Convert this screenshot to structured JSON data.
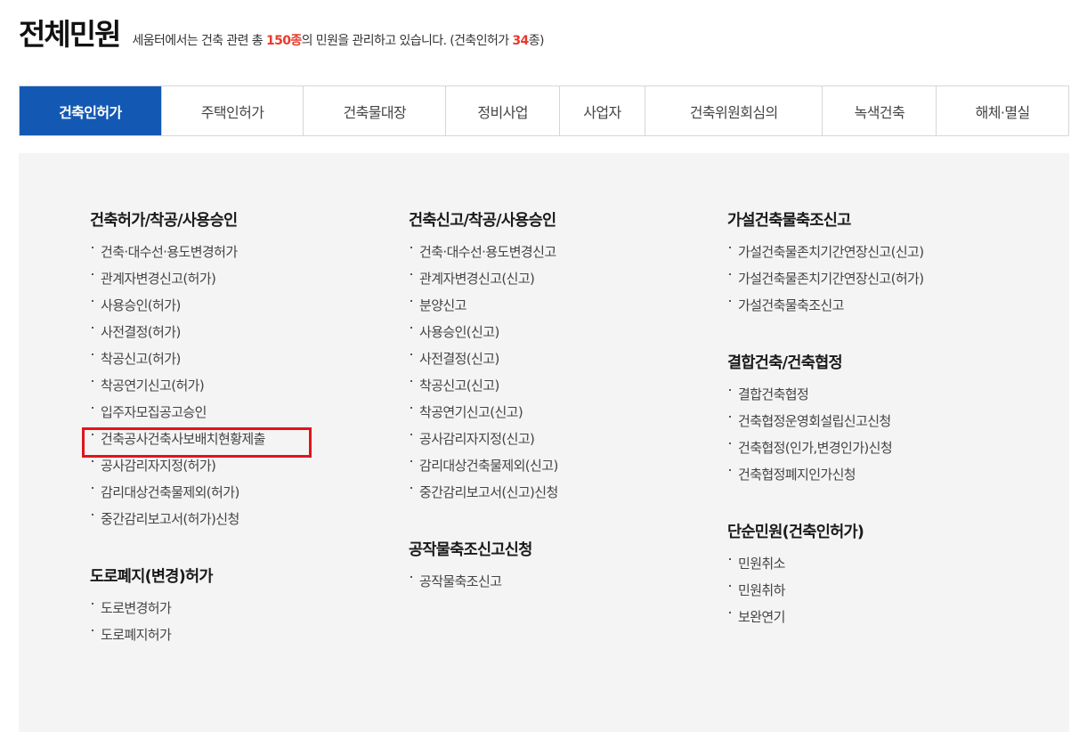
{
  "header": {
    "title": "전체민원",
    "subtitle_prefix": "세움터에서는 건축 관련 총 ",
    "total_count": "150종",
    "subtitle_mid": "의 민원을 관리하고 있습니다. (건축인허가 ",
    "permit_count": "34",
    "subtitle_suffix": "종)"
  },
  "tabs": [
    {
      "label": "건축인허가",
      "active": true
    },
    {
      "label": "주택인허가"
    },
    {
      "label": "건축물대장"
    },
    {
      "label": "정비사업"
    },
    {
      "label": "사업자"
    },
    {
      "label": "건축위원회심의"
    },
    {
      "label": "녹색건축"
    },
    {
      "label": "해체·멸실"
    }
  ],
  "columns": [
    {
      "groups": [
        {
          "title": "건축허가/착공/사용승인",
          "items": [
            "건축·대수선·용도변경허가",
            "관계자변경신고(허가)",
            "사용승인(허가)",
            "사전결정(허가)",
            "착공신고(허가)",
            "착공연기신고(허가)",
            "입주자모집공고승인",
            "건축공사건축사보배치현황제출",
            "공사감리자지정(허가)",
            "감리대상건축물제외(허가)",
            "중간감리보고서(허가)신청"
          ]
        },
        {
          "title": "도로폐지(변경)허가",
          "items": [
            "도로변경허가",
            "도로폐지허가"
          ]
        }
      ]
    },
    {
      "groups": [
        {
          "title": "건축신고/착공/사용승인",
          "items": [
            "건축·대수선·용도변경신고",
            "관계자변경신고(신고)",
            "분양신고",
            "사용승인(신고)",
            "사전결정(신고)",
            "착공신고(신고)",
            "착공연기신고(신고)",
            "공사감리자지정(신고)",
            "감리대상건축물제외(신고)",
            "중간감리보고서(신고)신청"
          ]
        },
        {
          "title": "공작물축조신고신청",
          "items": [
            "공작물축조신고"
          ]
        }
      ]
    },
    {
      "groups": [
        {
          "title": "가설건축물축조신고",
          "items": [
            "가설건축물존치기간연장신고(신고)",
            "가설건축물존치기간연장신고(허가)",
            "가설건축물축조신고"
          ]
        },
        {
          "title": "결합건축/건축협정",
          "items": [
            "결합건축협정",
            "건축협정운영회설립신고신청",
            "건축협정(인가,변경인가)신청",
            "건축협정폐지인가신청"
          ]
        },
        {
          "title": "단순민원(건축인허가)",
          "items": [
            "민원취소",
            "민원취하",
            "보완연기"
          ]
        }
      ]
    }
  ],
  "colors": {
    "active_tab": "#1359b3",
    "highlight_count": "#e8392b",
    "highlight_box": "#e0141c",
    "panel_bg": "#f4f4f4"
  }
}
